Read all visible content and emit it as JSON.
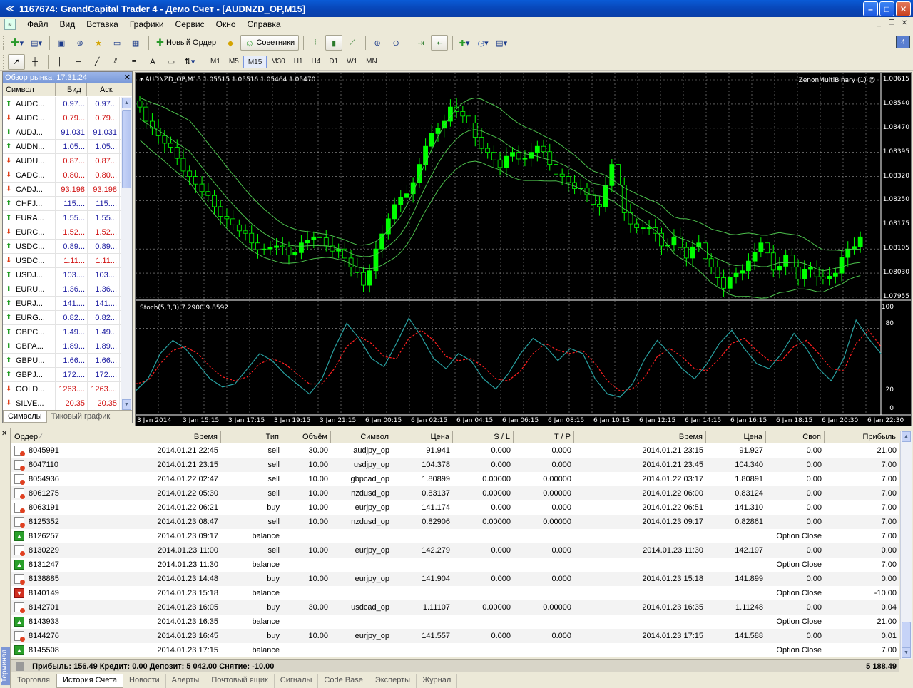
{
  "window": {
    "title": "1167674: GrandCapital Trader 4 - Демо Счет - [AUDNZD_OP,M15]"
  },
  "menu": [
    "Файл",
    "Вид",
    "Вставка",
    "Графики",
    "Сервис",
    "Окно",
    "Справка"
  ],
  "toolbar": {
    "new_order": "Новый Ордер",
    "experts": "Советники",
    "timeframes": [
      "M1",
      "M5",
      "M15",
      "M30",
      "H1",
      "H4",
      "D1",
      "W1",
      "MN"
    ],
    "active_tf": "M15",
    "info_badge": "4"
  },
  "market_watch": {
    "title": "Обзор рынка: 17:31:24",
    "headers": {
      "symbol": "Символ",
      "bid": "Бид",
      "ask": "Аск"
    },
    "rows": [
      {
        "symbol": "AUDC...",
        "bid": "0.97...",
        "ask": "0.97...",
        "dir": "up"
      },
      {
        "symbol": "AUDC...",
        "bid": "0.79...",
        "ask": "0.79...",
        "dir": "down"
      },
      {
        "symbol": "AUDJ...",
        "bid": "91.031",
        "ask": "91.031",
        "dir": "up"
      },
      {
        "symbol": "AUDN...",
        "bid": "1.05...",
        "ask": "1.05...",
        "dir": "up"
      },
      {
        "symbol": "AUDU...",
        "bid": "0.87...",
        "ask": "0.87...",
        "dir": "down"
      },
      {
        "symbol": "CADC...",
        "bid": "0.80...",
        "ask": "0.80...",
        "dir": "down"
      },
      {
        "symbol": "CADJ...",
        "bid": "93.198",
        "ask": "93.198",
        "dir": "down"
      },
      {
        "symbol": "CHFJ...",
        "bid": "115....",
        "ask": "115....",
        "dir": "up"
      },
      {
        "symbol": "EURA...",
        "bid": "1.55...",
        "ask": "1.55...",
        "dir": "up"
      },
      {
        "symbol": "EURC...",
        "bid": "1.52...",
        "ask": "1.52...",
        "dir": "down"
      },
      {
        "symbol": "USDC...",
        "bid": "0.89...",
        "ask": "0.89...",
        "dir": "up"
      },
      {
        "symbol": "USDC...",
        "bid": "1.11...",
        "ask": "1.11...",
        "dir": "down"
      },
      {
        "symbol": "USDJ...",
        "bid": "103....",
        "ask": "103....",
        "dir": "up"
      },
      {
        "symbol": "EURU...",
        "bid": "1.36...",
        "ask": "1.36...",
        "dir": "up"
      },
      {
        "symbol": "EURJ...",
        "bid": "141....",
        "ask": "141....",
        "dir": "up"
      },
      {
        "symbol": "EURG...",
        "bid": "0.82...",
        "ask": "0.82...",
        "dir": "up"
      },
      {
        "symbol": "GBPC...",
        "bid": "1.49...",
        "ask": "1.49...",
        "dir": "up"
      },
      {
        "symbol": "GBPA...",
        "bid": "1.89...",
        "ask": "1.89...",
        "dir": "up"
      },
      {
        "symbol": "GBPU...",
        "bid": "1.66...",
        "ask": "1.66...",
        "dir": "up"
      },
      {
        "symbol": "GBPJ...",
        "bid": "172....",
        "ask": "172....",
        "dir": "up"
      },
      {
        "symbol": "GOLD...",
        "bid": "1263....",
        "ask": "1263....",
        "dir": "down"
      },
      {
        "symbol": "SILVE...",
        "bid": "20.35",
        "ask": "20.35",
        "dir": "down"
      }
    ],
    "tabs": [
      "Символы",
      "Тиковый график"
    ]
  },
  "chart": {
    "header": "AUDNZD_OP,M15  1.05515 1.05516 1.05464 1.05470",
    "expert": "ZenonMultiBinary (1)",
    "indicator": "Stoch(5,3,3) 7.2900 9.8592",
    "price_ticks": [
      "1.08615",
      "1.08540",
      "1.08470",
      "1.08395",
      "1.08320",
      "1.08250",
      "1.08175",
      "1.08105",
      "1.08030",
      "1.07955"
    ],
    "stoch_ticks": [
      "100",
      "80",
      "20",
      "0"
    ],
    "time_ticks": [
      "3 Jan 2014",
      "3 Jan 15:15",
      "3 Jan 17:15",
      "3 Jan 19:15",
      "3 Jan 21:15",
      "6 Jan 00:15",
      "6 Jan 02:15",
      "6 Jan 04:15",
      "6 Jan 06:15",
      "6 Jan 08:15",
      "6 Jan 10:15",
      "6 Jan 12:15",
      "6 Jan 14:15",
      "6 Jan 16:15",
      "6 Jan 18:15",
      "6 Jan 20:30",
      "6 Jan 22:30"
    ],
    "colors": {
      "bull": "#00ff00",
      "bear": "#000000",
      "bands": "#4cc04c",
      "stoch_main": "#28a0a0",
      "stoch_signal": "#ff2020"
    }
  },
  "chart_data": {
    "type": "candlestick",
    "title": "AUDNZD_OP,M15",
    "ylim": [
      1.0792,
      1.0864
    ],
    "stoch_levels": [
      20,
      80
    ],
    "closes": [
      1.0855,
      1.0848,
      1.0843,
      1.0838,
      1.0832,
      1.0827,
      1.0822,
      1.0818,
      1.0814,
      1.081,
      1.0808,
      1.0809,
      1.0806,
      1.081,
      1.0812,
      1.0809,
      1.0808,
      1.0802,
      1.0796,
      1.0808,
      1.0818,
      1.0825,
      1.083,
      1.0842,
      1.0848,
      1.0855,
      1.0852,
      1.0845,
      1.084,
      1.0835,
      1.084,
      1.0838,
      1.0842,
      1.0836,
      1.0832,
      1.0828,
      1.0826,
      1.0822,
      1.0836,
      1.082,
      1.0815,
      1.0815,
      1.0809,
      1.0812,
      1.0805,
      1.081,
      1.0802,
      1.0795,
      1.08,
      1.0804,
      1.081,
      1.0801,
      1.0806,
      1.0798,
      1.0802,
      1.0798,
      1.08,
      1.0808,
      1.0812
    ],
    "stoch_main": [
      18,
      30,
      55,
      68,
      60,
      45,
      30,
      22,
      25,
      40,
      55,
      48,
      35,
      25,
      15,
      30,
      60,
      85,
      70,
      50,
      42,
      65,
      90,
      72,
      50,
      40,
      55,
      48,
      30,
      20,
      35,
      55,
      70,
      62,
      48,
      60,
      55,
      30,
      15,
      12,
      25,
      50,
      68,
      55,
      40,
      30,
      45,
      65,
      78,
      60,
      45,
      40,
      55,
      75,
      60,
      40,
      28,
      50,
      88,
      70,
      55
    ],
    "stoch_signal": [
      25,
      28,
      45,
      58,
      62,
      55,
      42,
      32,
      28,
      32,
      45,
      50,
      45,
      35,
      25,
      25,
      40,
      62,
      72,
      65,
      52,
      50,
      70,
      78,
      68,
      52,
      48,
      50,
      42,
      30,
      28,
      38,
      55,
      65,
      58,
      55,
      58,
      45,
      28,
      18,
      20,
      32,
      52,
      60,
      52,
      40,
      38,
      50,
      65,
      70,
      58,
      48,
      48,
      62,
      68,
      55,
      40,
      38,
      65,
      78,
      62
    ]
  },
  "terminal": {
    "vertical_title": "Терминал",
    "headers": {
      "order": "Ордер",
      "time": "Время",
      "type": "Тип",
      "volume": "Объём",
      "symbol": "Символ",
      "price": "Цена",
      "sl": "S / L",
      "tp": "T / P",
      "close_time": "Время",
      "close_price": "Цена",
      "swap": "Своп",
      "profit": "Прибыль"
    },
    "rows": [
      {
        "icon": "trade",
        "order": "8045991",
        "time": "2014.01.21 22:45",
        "type": "sell",
        "volume": "30.00",
        "symbol": "audjpy_op",
        "price": "91.941",
        "sl": "0.000",
        "tp": "0.000",
        "close_time": "2014.01.21 23:15",
        "close_price": "91.927",
        "swap": "0.00",
        "profit": "21.00"
      },
      {
        "icon": "trade",
        "order": "8047110",
        "time": "2014.01.21 23:15",
        "type": "sell",
        "volume": "10.00",
        "symbol": "usdjpy_op",
        "price": "104.378",
        "sl": "0.000",
        "tp": "0.000",
        "close_time": "2014.01.21 23:45",
        "close_price": "104.340",
        "swap": "0.00",
        "profit": "7.00"
      },
      {
        "icon": "trade",
        "order": "8054936",
        "time": "2014.01.22 02:47",
        "type": "sell",
        "volume": "10.00",
        "symbol": "gbpcad_op",
        "price": "1.80899",
        "sl": "0.00000",
        "tp": "0.00000",
        "close_time": "2014.01.22 03:17",
        "close_price": "1.80891",
        "swap": "0.00",
        "profit": "7.00"
      },
      {
        "icon": "trade",
        "order": "8061275",
        "time": "2014.01.22 05:30",
        "type": "sell",
        "volume": "10.00",
        "symbol": "nzdusd_op",
        "price": "0.83137",
        "sl": "0.00000",
        "tp": "0.00000",
        "close_time": "2014.01.22 06:00",
        "close_price": "0.83124",
        "swap": "0.00",
        "profit": "7.00"
      },
      {
        "icon": "trade",
        "order": "8063191",
        "time": "2014.01.22 06:21",
        "type": "buy",
        "volume": "10.00",
        "symbol": "eurjpy_op",
        "price": "141.174",
        "sl": "0.000",
        "tp": "0.000",
        "close_time": "2014.01.22 06:51",
        "close_price": "141.310",
        "swap": "0.00",
        "profit": "7.00"
      },
      {
        "icon": "trade",
        "order": "8125352",
        "time": "2014.01.23 08:47",
        "type": "sell",
        "volume": "10.00",
        "symbol": "nzdusd_op",
        "price": "0.82906",
        "sl": "0.00000",
        "tp": "0.00000",
        "close_time": "2014.01.23 09:17",
        "close_price": "0.82861",
        "swap": "0.00",
        "profit": "7.00"
      },
      {
        "icon": "bal-up",
        "order": "8126257",
        "time": "2014.01.23 09:17",
        "type": "balance",
        "volume": "",
        "symbol": "",
        "price": "",
        "sl": "",
        "tp": "",
        "close_time": "",
        "close_price": "",
        "swap": "Option Close",
        "profit": "7.00"
      },
      {
        "icon": "trade",
        "order": "8130229",
        "time": "2014.01.23 11:00",
        "type": "sell",
        "volume": "10.00",
        "symbol": "eurjpy_op",
        "price": "142.279",
        "sl": "0.000",
        "tp": "0.000",
        "close_time": "2014.01.23 11:30",
        "close_price": "142.197",
        "swap": "0.00",
        "profit": "0.00"
      },
      {
        "icon": "bal-up",
        "order": "8131247",
        "time": "2014.01.23 11:30",
        "type": "balance",
        "volume": "",
        "symbol": "",
        "price": "",
        "sl": "",
        "tp": "",
        "close_time": "",
        "close_price": "",
        "swap": "Option Close",
        "profit": "7.00"
      },
      {
        "icon": "trade",
        "order": "8138885",
        "time": "2014.01.23 14:48",
        "type": "buy",
        "volume": "10.00",
        "symbol": "eurjpy_op",
        "price": "141.904",
        "sl": "0.000",
        "tp": "0.000",
        "close_time": "2014.01.23 15:18",
        "close_price": "141.899",
        "swap": "0.00",
        "profit": "0.00"
      },
      {
        "icon": "bal-down",
        "order": "8140149",
        "time": "2014.01.23 15:18",
        "type": "balance",
        "volume": "",
        "symbol": "",
        "price": "",
        "sl": "",
        "tp": "",
        "close_time": "",
        "close_price": "",
        "swap": "Option Close",
        "profit": "-10.00"
      },
      {
        "icon": "trade",
        "order": "8142701",
        "time": "2014.01.23 16:05",
        "type": "buy",
        "volume": "30.00",
        "symbol": "usdcad_op",
        "price": "1.11107",
        "sl": "0.00000",
        "tp": "0.00000",
        "close_time": "2014.01.23 16:35",
        "close_price": "1.11248",
        "swap": "0.00",
        "profit": "0.04"
      },
      {
        "icon": "bal-up",
        "order": "8143933",
        "time": "2014.01.23 16:35",
        "type": "balance",
        "volume": "",
        "symbol": "",
        "price": "",
        "sl": "",
        "tp": "",
        "close_time": "",
        "close_price": "",
        "swap": "Option Close",
        "profit": "21.00"
      },
      {
        "icon": "trade",
        "order": "8144276",
        "time": "2014.01.23 16:45",
        "type": "buy",
        "volume": "10.00",
        "symbol": "eurjpy_op",
        "price": "141.557",
        "sl": "0.000",
        "tp": "0.000",
        "close_time": "2014.01.23 17:15",
        "close_price": "141.588",
        "swap": "0.00",
        "profit": "0.01"
      },
      {
        "icon": "bal-up",
        "order": "8145508",
        "time": "2014.01.23 17:15",
        "type": "balance",
        "volume": "",
        "symbol": "",
        "price": "",
        "sl": "",
        "tp": "",
        "close_time": "",
        "close_price": "",
        "swap": "Option Close",
        "profit": "7.00"
      }
    ],
    "summary": "Прибыль: 156.49  Кредит: 0.00  Депозит: 5 042.00  Снятие: -10.00",
    "total": "5 188.49",
    "tabs": [
      "Торговля",
      "История Счета",
      "Новости",
      "Алерты",
      "Почтовый ящик",
      "Сигналы",
      "Code Base",
      "Эксперты",
      "Журнал"
    ],
    "active_tab": "История Счета"
  }
}
